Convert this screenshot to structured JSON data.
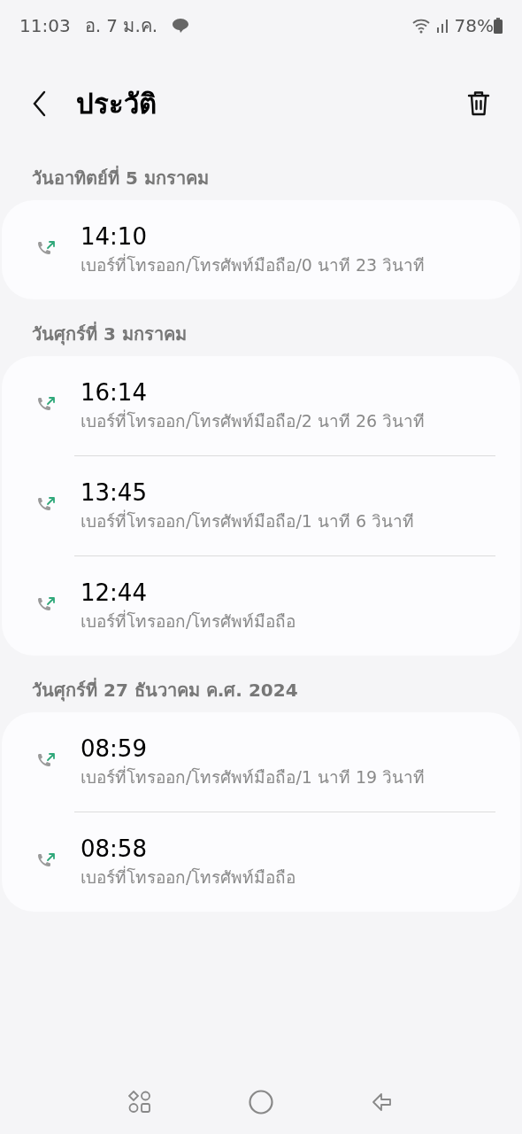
{
  "status_bar": {
    "time": "11:03",
    "date": "อ. 7 ม.ค.",
    "battery": "78%"
  },
  "header": {
    "title": "ประวัติ"
  },
  "sections": [
    {
      "date": "วันอาทิตย์ที่ 5 มกราคม",
      "calls": [
        {
          "time": "14:10",
          "detail": "เบอร์ที่โทรออก/โทรศัพท์มือถือ/0 นาที 23 วินาที"
        }
      ]
    },
    {
      "date": "วันศุกร์ที่ 3 มกราคม",
      "calls": [
        {
          "time": "16:14",
          "detail": "เบอร์ที่โทรออก/โทรศัพท์มือถือ/2 นาที 26 วินาที"
        },
        {
          "time": "13:45",
          "detail": "เบอร์ที่โทรออก/โทรศัพท์มือถือ/1 นาที 6 วินาที"
        },
        {
          "time": "12:44",
          "detail": "เบอร์ที่โทรออก/โทรศัพท์มือถือ"
        }
      ]
    },
    {
      "date": "วันศุกร์ที่ 27 ธันวาคม ค.ศ. 2024",
      "calls": [
        {
          "time": "08:59",
          "detail": "เบอร์ที่โทรออก/โทรศัพท์มือถือ/1 นาที 19 วินาที"
        },
        {
          "time": "08:58",
          "detail": "เบอร์ที่โทรออก/โทรศัพท์มือถือ"
        }
      ]
    }
  ]
}
